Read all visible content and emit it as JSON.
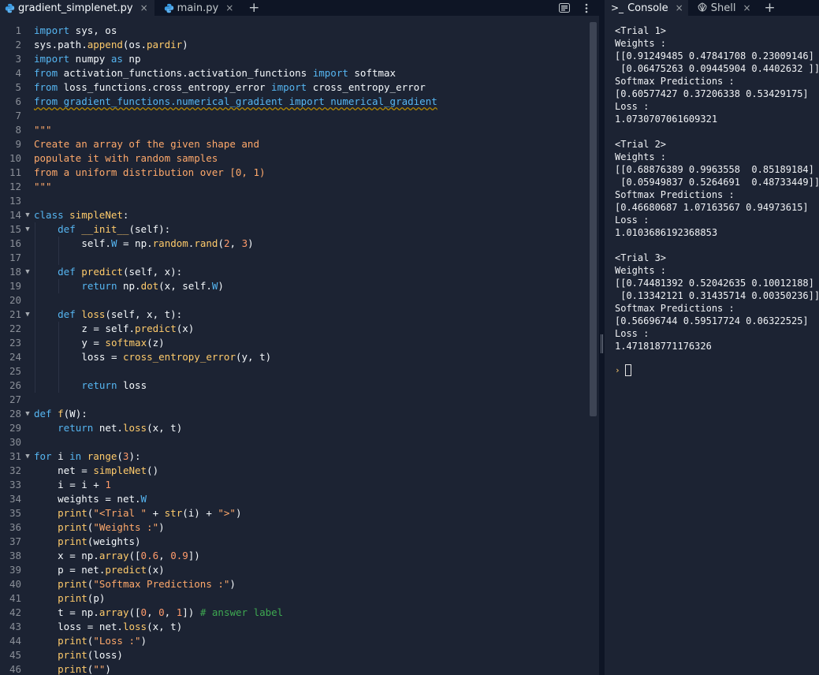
{
  "editor": {
    "tabs": [
      {
        "label": "gradient_simplenet.py",
        "active": true
      },
      {
        "label": "main.py",
        "active": false
      }
    ],
    "close_glyph": "×",
    "add_glyph": "+",
    "tools": [
      "keyboard-icon",
      "more-vertical-icon"
    ]
  },
  "code_lines": [
    {
      "n": "1"
    },
    {
      "n": "2"
    },
    {
      "n": "3"
    },
    {
      "n": "4"
    },
    {
      "n": "5"
    },
    {
      "n": "6"
    },
    {
      "n": "7"
    },
    {
      "n": "8"
    },
    {
      "n": "9"
    },
    {
      "n": "10"
    },
    {
      "n": "11"
    },
    {
      "n": "12"
    },
    {
      "n": "13"
    },
    {
      "n": "14"
    },
    {
      "n": "15"
    },
    {
      "n": "16"
    },
    {
      "n": "17"
    },
    {
      "n": "18"
    },
    {
      "n": "19"
    },
    {
      "n": "20"
    },
    {
      "n": "21"
    },
    {
      "n": "22"
    },
    {
      "n": "23"
    },
    {
      "n": "24"
    },
    {
      "n": "25"
    },
    {
      "n": "26"
    },
    {
      "n": "27"
    },
    {
      "n": "28"
    },
    {
      "n": "29"
    },
    {
      "n": "30"
    },
    {
      "n": "31"
    },
    {
      "n": "32"
    },
    {
      "n": "33"
    },
    {
      "n": "34"
    },
    {
      "n": "35"
    },
    {
      "n": "36"
    },
    {
      "n": "37"
    },
    {
      "n": "38"
    },
    {
      "n": "39"
    },
    {
      "n": "40"
    },
    {
      "n": "41"
    },
    {
      "n": "42"
    },
    {
      "n": "43"
    },
    {
      "n": "44"
    },
    {
      "n": "45"
    },
    {
      "n": "46"
    }
  ],
  "code": {
    "l1": [
      "import",
      " sys, os"
    ],
    "l2": [
      "sys.path.",
      "append",
      "(os.",
      "pardir",
      ")"
    ],
    "l3": [
      "import",
      " numpy ",
      "as",
      " np"
    ],
    "l4": [
      "from",
      " activation_functions.activation_functions ",
      "import",
      " softmax"
    ],
    "l5": [
      "from",
      " loss_functions.cross_entropy_error ",
      "import",
      " cross_entropy_error"
    ],
    "l6": [
      "from gradient_functions.numerical_gradient import numerical_gradient"
    ],
    "l8": [
      "\"\"\""
    ],
    "l9": [
      "Create an array of the given shape and"
    ],
    "l10": [
      "populate it with random samples"
    ],
    "l11": [
      "from a uniform distribution over [0, 1)"
    ],
    "l12": [
      "\"\"\""
    ],
    "l14": [
      "class",
      " ",
      "simpleNet",
      ":"
    ],
    "l15": [
      "def",
      " ",
      "__init__",
      "(self):"
    ],
    "l16": [
      "self.",
      "W",
      " = np.",
      "random",
      ".",
      "rand",
      "(",
      "2",
      ", ",
      "3",
      ")"
    ],
    "l18": [
      "def",
      " ",
      "predict",
      "(self, x):"
    ],
    "l19": [
      "return",
      " np.",
      "dot",
      "(x, self.",
      "W",
      ")"
    ],
    "l21": [
      "def",
      " ",
      "loss",
      "(self, x, t):"
    ],
    "l22": [
      "z = self.",
      "predict",
      "(x)"
    ],
    "l23": [
      "y = ",
      "softmax",
      "(z)"
    ],
    "l24": [
      "loss = ",
      "cross_entropy_error",
      "(y, t)"
    ],
    "l26": [
      "return",
      " loss"
    ],
    "l28": [
      "def",
      " ",
      "f",
      "(W):"
    ],
    "l29": [
      "return",
      " net.",
      "loss",
      "(x, t)"
    ],
    "l31": [
      "for",
      " i ",
      "in",
      " ",
      "range",
      "(",
      "3",
      "):"
    ],
    "l32": [
      "net = ",
      "simpleNet",
      "()"
    ],
    "l33": [
      "i = i + ",
      "1"
    ],
    "l34": [
      "weights = net.",
      "W"
    ],
    "l35": [
      "print",
      "(",
      "\"<Trial \"",
      " + ",
      "str",
      "(i) + ",
      "\">\"",
      ")"
    ],
    "l36": [
      "print",
      "(",
      "\"Weights :\"",
      ")"
    ],
    "l37": [
      "print",
      "(weights)"
    ],
    "l38": [
      "x = np.",
      "array",
      "([",
      "0.6",
      ", ",
      "0.9",
      "])"
    ],
    "l39": [
      "p = net.",
      "predict",
      "(x)"
    ],
    "l40": [
      "print",
      "(",
      "\"Softmax Predictions :\"",
      ")"
    ],
    "l41": [
      "print",
      "(p)"
    ],
    "l42": [
      "t = np.",
      "array",
      "([",
      "0",
      ", ",
      "0",
      ", ",
      "1",
      "]) ",
      "# answer label"
    ],
    "l43": [
      "loss = net.",
      "loss",
      "(x, t)"
    ],
    "l44": [
      "print",
      "(",
      "\"Loss :\"",
      ")"
    ],
    "l45": [
      "print",
      "(loss)"
    ],
    "l46": [
      "print",
      "(",
      "\"\"",
      ")"
    ]
  },
  "console": {
    "tabs": [
      {
        "glyph": ">_",
        "label": "Console",
        "active": true
      },
      {
        "glyph": "",
        "label": "Shell",
        "active": false
      }
    ],
    "output": [
      "<Trial 1>",
      "Weights :",
      "[[0.91249485 0.47841708 0.23009146]",
      " [0.06475263 0.09445904 0.4402632 ]]",
      "Softmax Predictions :",
      "[0.60577427 0.37206338 0.53429175]",
      "Loss :",
      "1.0730707061609321",
      "",
      "<Trial 2>",
      "Weights :",
      "[[0.68876389 0.9963558  0.85189184]",
      " [0.05949837 0.5264691  0.48733449]]",
      "Softmax Predictions :",
      "[0.46680687 1.07163567 0.94973615]",
      "Loss :",
      "1.0103686192368853",
      "",
      "<Trial 3>",
      "Weights :",
      "[[0.74481392 0.52042635 0.10012188]",
      " [0.13342121 0.31435714 0.00350236]]",
      "Softmax Predictions :",
      "[0.56696744 0.59517724 0.06322525]",
      "Loss :",
      "1.471818771176326"
    ],
    "prompt": "›"
  }
}
